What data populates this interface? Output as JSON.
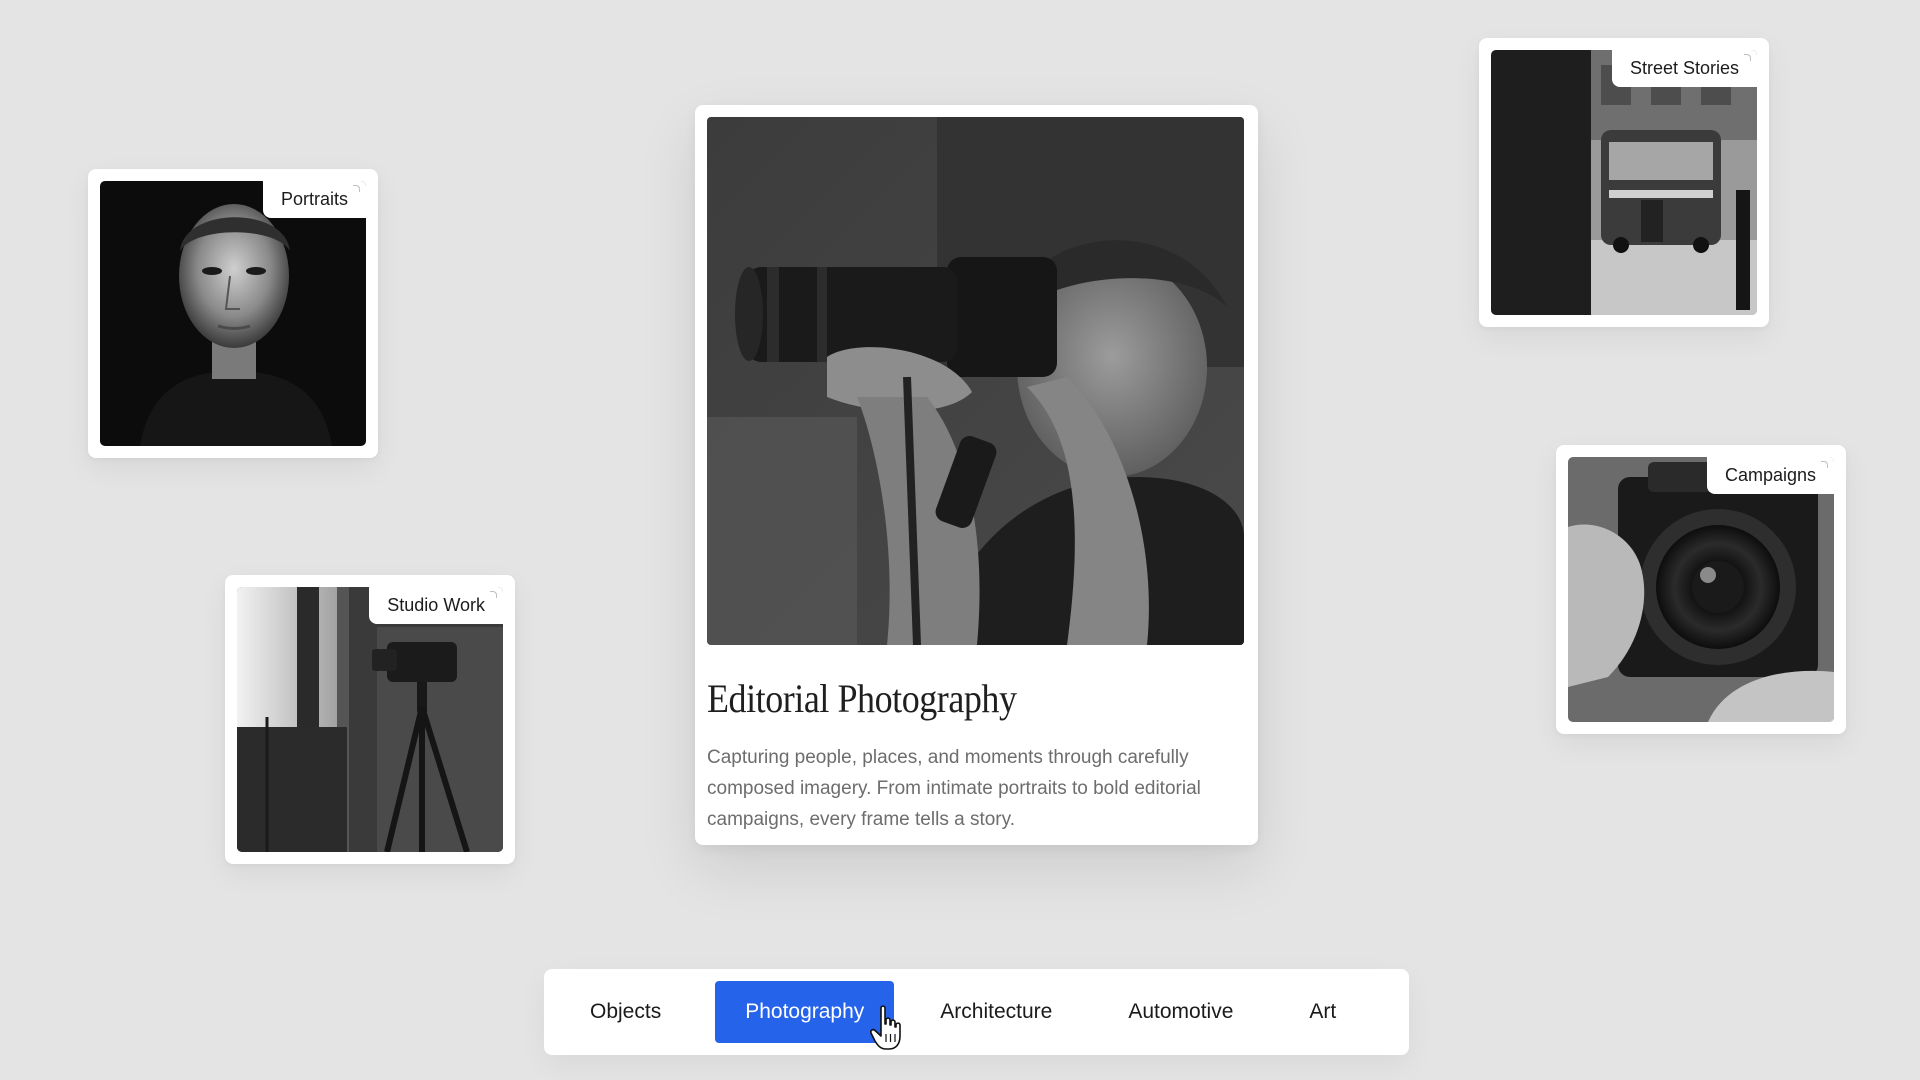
{
  "featured": {
    "title": "Editorial Photography",
    "description": "Capturing people, places, and moments through carefully composed imagery. From intimate portraits to bold editorial campaigns, every frame tells a story."
  },
  "cards": {
    "portraits": {
      "label": "Portraits"
    },
    "studio": {
      "label": "Studio Work"
    },
    "street": {
      "label": "Street Stories"
    },
    "campaigns": {
      "label": "Campaigns"
    }
  },
  "nav": {
    "tabs": [
      {
        "label": "Objects",
        "active": false
      },
      {
        "label": "Photography",
        "active": true
      },
      {
        "label": "Architecture",
        "active": false
      },
      {
        "label": "Automotive",
        "active": false
      },
      {
        "label": "Art",
        "active": false
      }
    ]
  },
  "colors": {
    "accent": "#2563eb",
    "background": "#e4e4e4",
    "card": "#ffffff"
  },
  "icons": {
    "cursor": "hand-pointer-icon"
  }
}
